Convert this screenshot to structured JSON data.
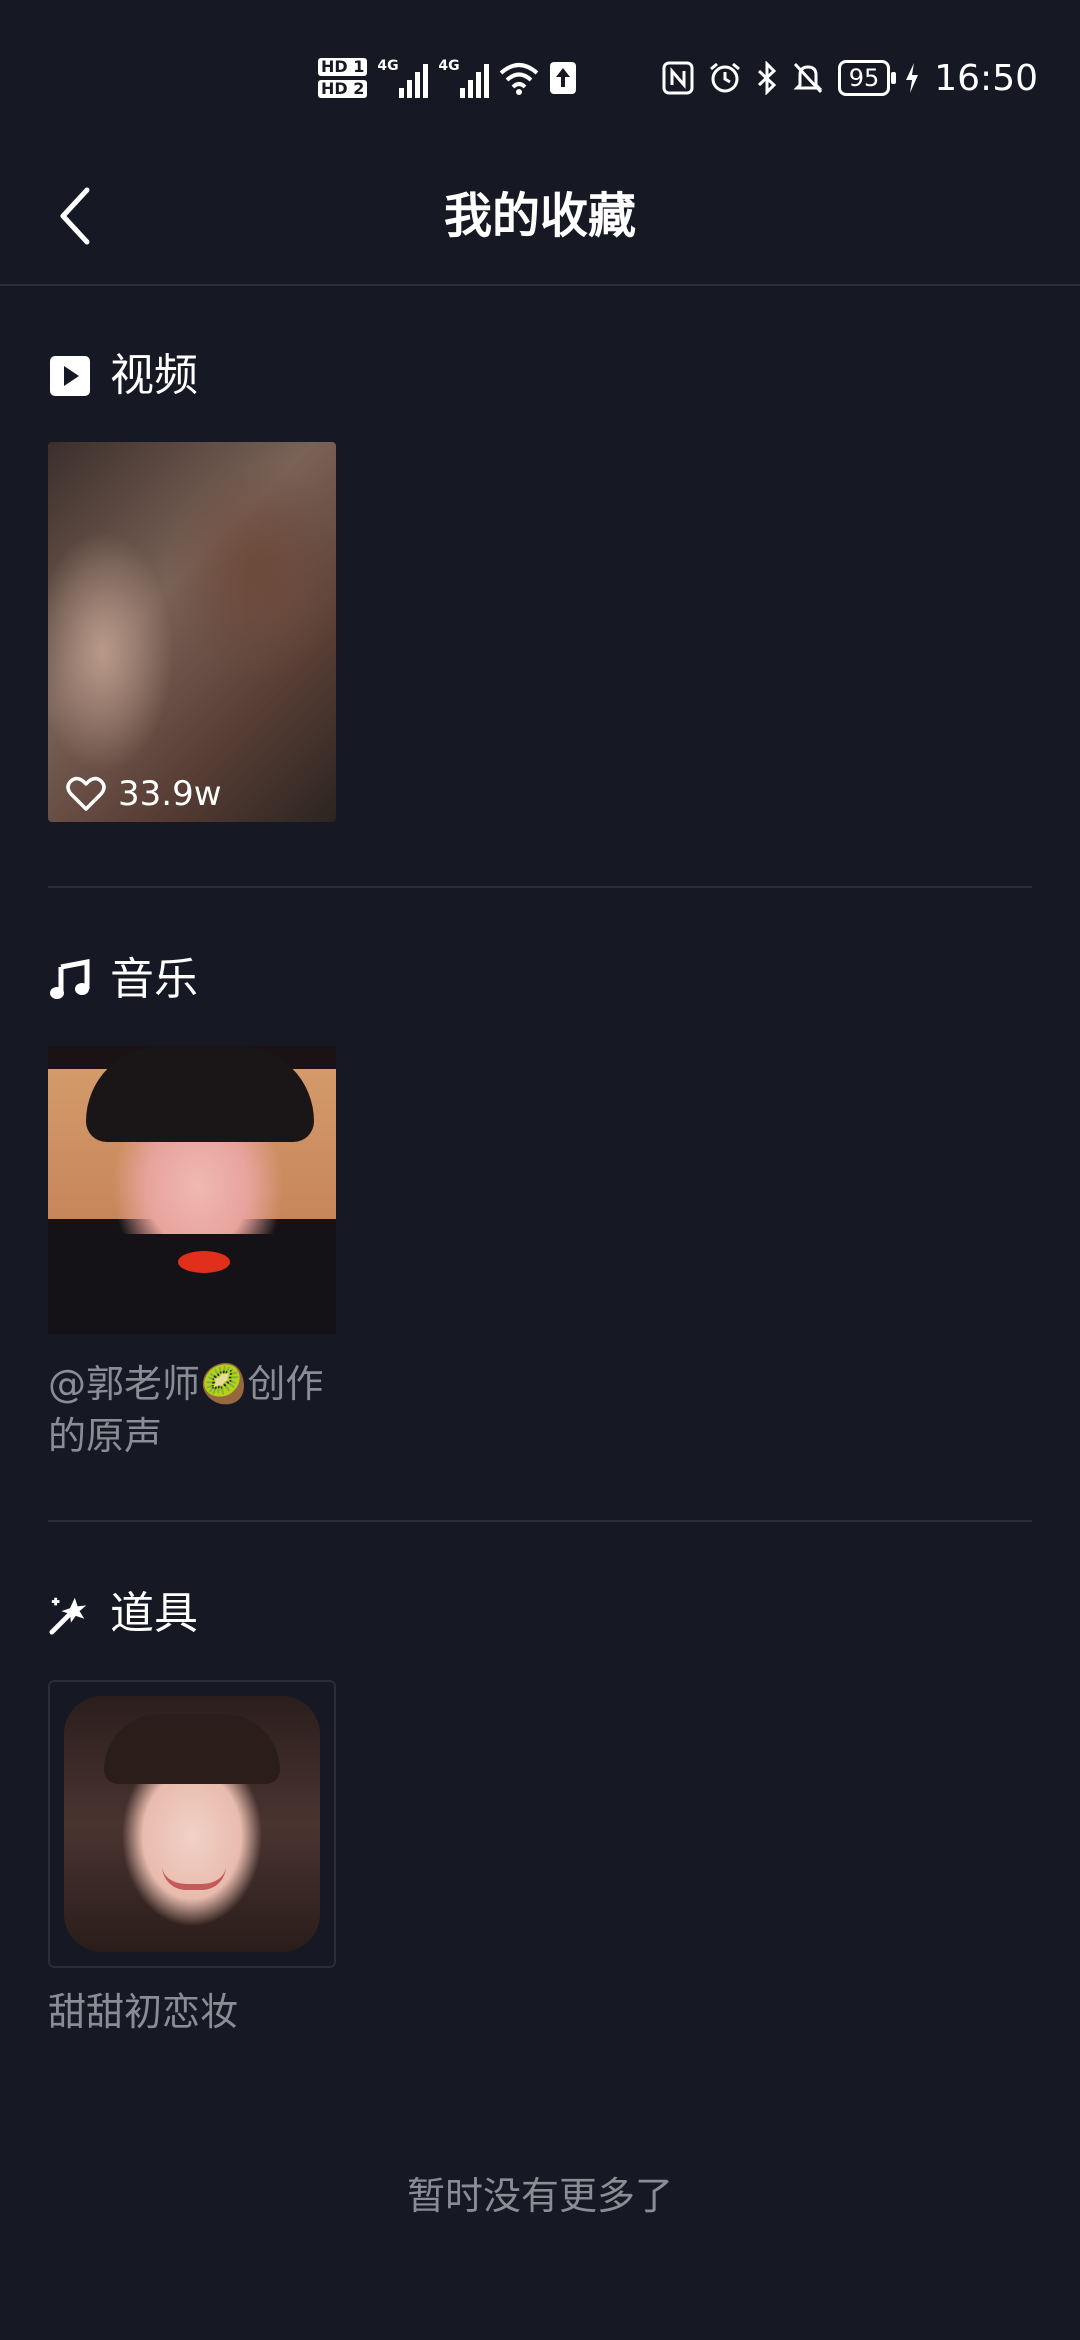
{
  "status_bar": {
    "hd1": "HD 1",
    "hd2": "HD 2",
    "net1": "4G",
    "net2": "4G",
    "battery": "95",
    "time": "16:50",
    "icons": [
      "nfc-icon",
      "alarm-icon",
      "bluetooth-icon",
      "mute-icon",
      "charging-icon",
      "wifi-icon",
      "upload-icon"
    ]
  },
  "header": {
    "title": "我的收藏",
    "back_icon": "chevron-left-icon"
  },
  "sections": {
    "video": {
      "title": "视频",
      "icon": "play-square-icon",
      "items": [
        {
          "likes": "33.9w"
        }
      ]
    },
    "music": {
      "title": "音乐",
      "icon": "music-note-icon",
      "items": [
        {
          "caption": "@郭老师🥝创作的原声"
        }
      ]
    },
    "props": {
      "title": "道具",
      "icon": "magic-wand-icon",
      "items": [
        {
          "caption": "甜甜初恋妆"
        }
      ]
    }
  },
  "footer": {
    "end_text": "暂时没有更多了"
  },
  "colors": {
    "background": "#161824",
    "divider": "#2b2d39",
    "muted_text": "#8a8c96",
    "primary_text": "#ffffff"
  }
}
